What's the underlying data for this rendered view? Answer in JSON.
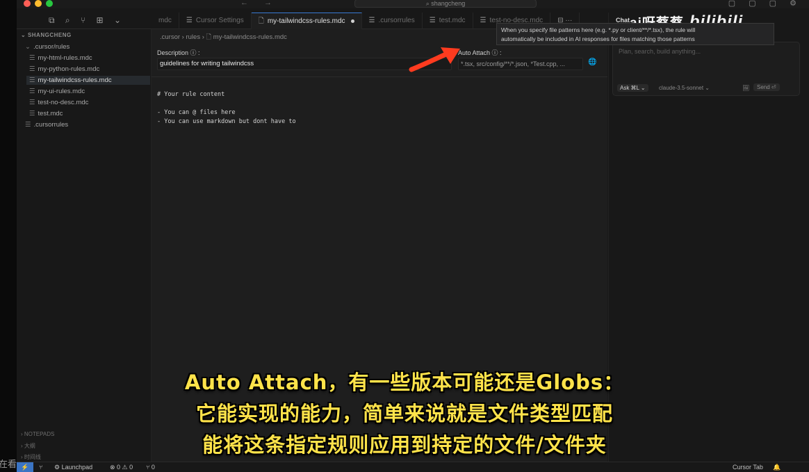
{
  "titlebar": {
    "search_text": "shangcheng",
    "nav": "←   →",
    "win_icons": "▢ ▢ ▢ ⚙"
  },
  "activity": [
    "⧉",
    "⌕",
    "⑂",
    "⊞",
    "⌄"
  ],
  "tabs": [
    {
      "label": "mdc",
      "icon": ""
    },
    {
      "label": "Cursor Settings",
      "icon": "☰"
    },
    {
      "label": "my-tailwindcss-rules.mdc",
      "icon": "🗋",
      "active": true,
      "dirty": true
    },
    {
      "label": ".cursorrules",
      "icon": "☰"
    },
    {
      "label": "test.mdc",
      "icon": "☰"
    },
    {
      "label": "test-no-desc.mdc",
      "icon": "☰"
    }
  ],
  "tab_actions": "⊟  ···",
  "sidebar": {
    "title": "SHANGCHENG",
    "folder": ".cursor/rules",
    "files": [
      "my-html-rules.mdc",
      "my-python-rules.mdc",
      "my-tailwindcss-rules.mdc",
      "my-ui-rules.mdc",
      "test-no-desc.mdc",
      "test.mdc"
    ],
    "root_file": ".cursorrules",
    "bottom": [
      "NOTEPADS",
      "大纲",
      "时间线"
    ]
  },
  "editor": {
    "breadcrumb": ".cursor  ›  rules  ›  🗋 my-tailwindcss-rules.mdc",
    "description_label": "Description ⓘ :",
    "description_value": "guidelines for writing tailwindcss",
    "auto_attach_label": "Auto Attach ⓘ :",
    "auto_attach_placeholder": "*.tsx, src/config/**/*.json, *Test.cpp, ...",
    "globe": "🌐",
    "code": [
      "# Your rule content",
      "",
      "- You can @ files here",
      "- You can use markdown but dont have to"
    ]
  },
  "tooltip": {
    "line1": "When you specify file patterns here (e.g. *.py or client/**/*.tsx), the rule will",
    "line2": "automatically be included in AI responses for files matching those patterns"
  },
  "chat": {
    "title": "Chat",
    "placeholder": "Plan, search, build anything...",
    "mode": "Ask ⌘L ⌄",
    "model": "claude-3.5-sonnet ⌄",
    "image_icon": "🖼",
    "send": "Send ⏎"
  },
  "statusbar": {
    "remote": "⚡",
    "branch": "⑂",
    "launchpad": "⚙ Launchpad",
    "problems": "⊗ 0 ⚠ 0",
    "ports": "⑂ 0",
    "cursor_tab": "Cursor Tab",
    "bell": "🔔"
  },
  "overlay": {
    "watermark": "ai呀蔡蔡",
    "watermark_logo": "bilibili",
    "left_edge_text": "在看",
    "subtitles": [
      "Auto Attach，有一些版本可能还是Globs：",
      "它能实现的能力，简单来说就是文件类型匹配",
      "能将这条指定规则应用到持定的文件/文件夹"
    ]
  },
  "colors": {
    "arrow": "#ff3b1f",
    "subtitle": "#ffe34a",
    "accent": "#3a7bd5"
  }
}
